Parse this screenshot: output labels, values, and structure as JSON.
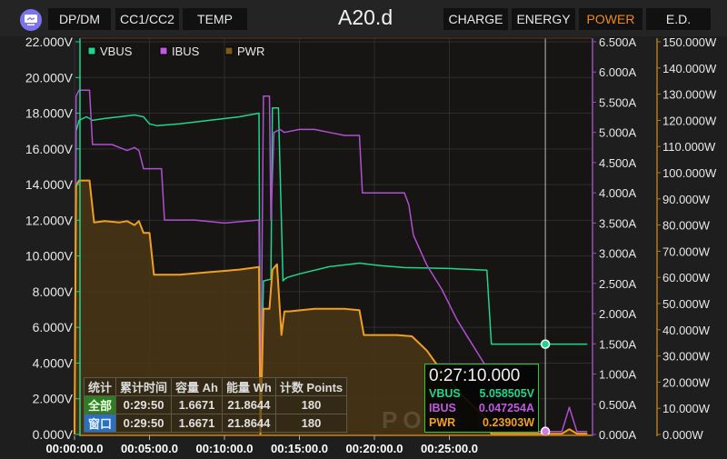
{
  "header": {
    "logo_icon": "monitor-app-icon",
    "title": "A20.d",
    "left_tabs": [
      {
        "label": "DP/DM",
        "active": false
      },
      {
        "label": "CC1/CC2",
        "active": false
      },
      {
        "label": "TEMP",
        "active": false
      }
    ],
    "right_tabs": [
      {
        "label": "CHARGE",
        "active": false
      },
      {
        "label": "ENERGY",
        "active": false
      },
      {
        "label": "POWER",
        "active": true
      },
      {
        "label": "E.D.",
        "active": false
      }
    ]
  },
  "colors": {
    "vbus": "#1fd68c",
    "ibus": "#b04fd0",
    "pwr": "#f0a020",
    "pwr_fill": "#4a3614",
    "active_tab": "#f08a1c",
    "tooltip_border": "#32c832"
  },
  "stats_table": {
    "headers": [
      "统计",
      "累计时间",
      "容量 Ah",
      "能量 Wh",
      "计数 Points"
    ],
    "rows": [
      {
        "label": "全部",
        "time": "0:29:50",
        "ah": "1.6671",
        "wh": "21.8644",
        "points": "180"
      },
      {
        "label": "窗口",
        "time": "0:29:50",
        "ah": "1.6671",
        "wh": "21.8644",
        "points": "180"
      }
    ]
  },
  "tooltip": {
    "time": "0:27:10.000",
    "rows": [
      {
        "name": "VBUS",
        "value": "5.058505V"
      },
      {
        "name": "IBUS",
        "value": "0.047254A"
      },
      {
        "name": "PWR",
        "value": "0.23903W"
      }
    ]
  },
  "watermark": "POWER-Z",
  "chart_data": {
    "type": "line",
    "title": "",
    "legend": {
      "placement": "top-left",
      "entries": [
        "VBUS",
        "IBUS",
        "PWR"
      ]
    },
    "grid": true,
    "x_axis": {
      "label": "",
      "unit": "minutes",
      "range": [
        0,
        34.2
      ],
      "ticks": [
        0,
        5,
        10,
        15,
        20,
        25
      ],
      "tick_labels": [
        "00:00:00.0",
        "00:05:00.0",
        "00:10:00.0",
        "00:15:00.0",
        "00:20:00.0",
        "00:25:00.0"
      ]
    },
    "y_axes": [
      {
        "id": "V",
        "side": "left",
        "range": [
          0,
          22
        ],
        "ticks": [
          0,
          2,
          4,
          6,
          8,
          10,
          12,
          14,
          16,
          18,
          20,
          22
        ],
        "tick_labels": [
          "0.000V",
          "2.000V",
          "4.000V",
          "6.000V",
          "8.000V",
          "10.000V",
          "12.000V",
          "14.000V",
          "16.000V",
          "18.000V",
          "20.000V",
          "22.000V"
        ]
      },
      {
        "id": "A",
        "side": "right",
        "range": [
          0,
          6.5
        ],
        "ticks": [
          0,
          0.5,
          1,
          1.5,
          2,
          2.5,
          3,
          3.5,
          4,
          4.5,
          5,
          5.5,
          6,
          6.5
        ],
        "tick_labels": [
          "0.000A",
          "0.500A",
          "1.000A",
          "1.500A",
          "2.000A",
          "2.500A",
          "3.000A",
          "3.500A",
          "4.000A",
          "4.500A",
          "5.000A",
          "5.500A",
          "6.000A",
          "6.500A"
        ]
      },
      {
        "id": "W",
        "side": "right",
        "range": [
          0,
          150
        ],
        "ticks": [
          0,
          10,
          20,
          30,
          40,
          50,
          60,
          70,
          80,
          90,
          100,
          110,
          120,
          130,
          140,
          150
        ],
        "tick_labels": [
          "0.000W",
          "10.000W",
          "20.000W",
          "30.000W",
          "40.000W",
          "50.000W",
          "60.000W",
          "70.000W",
          "80.000W",
          "90.000W",
          "100.000W",
          "110.000W",
          "120.000W",
          "130.000W",
          "140.000W",
          "150.000W"
        ]
      }
    ],
    "cursor_x": 31.4,
    "series": [
      {
        "name": "VBUS",
        "axis": "V",
        "x": [
          0,
          0.1,
          0.3,
          0.8,
          1.2,
          2.0,
          3.0,
          4.0,
          4.6,
          5.0,
          5.5,
          7,
          9,
          11,
          12.3,
          12.4,
          12.6,
          13.1,
          13.2,
          13.6,
          13.9,
          14.0,
          14.2,
          15,
          17,
          19,
          20,
          20.5,
          22,
          25,
          27.5,
          27.8,
          28.1,
          30,
          34.2
        ],
        "values": [
          0,
          17.0,
          17.6,
          17.8,
          17.6,
          17.7,
          17.8,
          17.9,
          17.8,
          17.4,
          17.3,
          17.4,
          17.6,
          17.8,
          18.0,
          0.5,
          8.6,
          8.7,
          18.3,
          18.3,
          8.6,
          8.7,
          8.8,
          9.0,
          9.4,
          9.6,
          9.5,
          9.45,
          9.35,
          9.3,
          9.2,
          5.06,
          5.06,
          5.06,
          5.06
        ]
      },
      {
        "name": "IBUS",
        "axis": "A",
        "x": [
          0,
          0.1,
          0.3,
          1.0,
          1.2,
          1.6,
          2.5,
          3.0,
          3.5,
          4.0,
          4.3,
          4.6,
          5.2,
          5.8,
          6.0,
          8,
          10,
          12.3,
          12.4,
          12.6,
          13.0,
          13.1,
          13.3,
          13.7,
          14.0,
          15,
          16,
          17,
          18,
          19,
          19.2,
          22,
          22.3,
          22.6,
          23.5,
          24.5,
          25.5,
          26.5,
          27.5,
          28,
          29,
          29.6,
          30.5,
          32.5,
          33,
          33.5,
          34.2
        ],
        "values": [
          0,
          5.6,
          5.7,
          5.7,
          4.8,
          4.8,
          4.8,
          4.75,
          4.7,
          4.75,
          4.7,
          4.4,
          4.4,
          4.4,
          3.55,
          3.55,
          3.5,
          3.55,
          0.05,
          5.6,
          5.6,
          3.55,
          5.0,
          5.05,
          5.0,
          5.05,
          5.05,
          5.0,
          4.95,
          4.95,
          4.0,
          4.0,
          3.8,
          3.3,
          2.8,
          2.4,
          1.9,
          1.5,
          1.1,
          0.8,
          0.2,
          0.05,
          0.05,
          0.05,
          0.45,
          0.05,
          0.05
        ]
      },
      {
        "name": "PWR",
        "axis": "W",
        "x": [
          0,
          0.1,
          0.3,
          1.0,
          1.3,
          2.0,
          3.0,
          3.5,
          4.0,
          4.3,
          4.6,
          5.0,
          5.3,
          7,
          9,
          11,
          12.3,
          12.4,
          12.6,
          13.0,
          13.2,
          13.5,
          13.8,
          14.0,
          14.3,
          16,
          18,
          19,
          19.3,
          21.5,
          22.5,
          23.5,
          24.5,
          26,
          27.5,
          27.8,
          28.1,
          30,
          32.5,
          33,
          33.5,
          34.2
        ],
        "values": [
          0,
          95,
          97,
          97,
          81,
          81.5,
          81,
          81.5,
          80,
          81.5,
          77,
          77,
          61,
          61,
          62,
          63,
          64,
          0.2,
          48,
          48,
          63,
          65,
          38,
          47,
          47,
          48,
          48,
          47.5,
          38,
          38,
          37.5,
          32,
          24,
          14,
          6,
          0.24,
          0.24,
          0.24,
          0.3,
          2,
          0.3,
          0.3
        ]
      }
    ]
  }
}
